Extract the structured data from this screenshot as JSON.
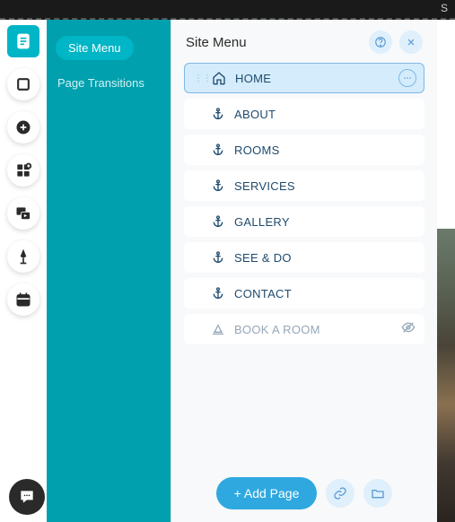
{
  "topbar": {
    "right_text": "S"
  },
  "teal": {
    "active_tab": "Site Menu",
    "link": "Page Transitions"
  },
  "panel": {
    "title": "Site Menu",
    "add_button": "+ Add Page"
  },
  "pages": [
    {
      "label": "HOME",
      "icon": "home",
      "selected": true,
      "dim": false
    },
    {
      "label": "ABOUT",
      "icon": "anchor",
      "selected": false,
      "dim": false
    },
    {
      "label": "ROOMS",
      "icon": "anchor",
      "selected": false,
      "dim": false
    },
    {
      "label": "SERVICES",
      "icon": "anchor",
      "selected": false,
      "dim": false
    },
    {
      "label": "GALLERY",
      "icon": "anchor",
      "selected": false,
      "dim": false
    },
    {
      "label": "SEE & DO",
      "icon": "anchor",
      "selected": false,
      "dim": false
    },
    {
      "label": "CONTACT",
      "icon": "anchor",
      "selected": false,
      "dim": false
    },
    {
      "label": "BOOK A ROOM",
      "icon": "bell",
      "selected": false,
      "dim": true
    }
  ],
  "rail": [
    {
      "name": "pages-icon",
      "active": true
    },
    {
      "name": "background-icon",
      "active": false
    },
    {
      "name": "add-icon",
      "active": false
    },
    {
      "name": "apps-icon",
      "active": false
    },
    {
      "name": "media-icon",
      "active": false
    },
    {
      "name": "blog-icon",
      "active": false
    },
    {
      "name": "bookings-icon",
      "active": false
    }
  ]
}
